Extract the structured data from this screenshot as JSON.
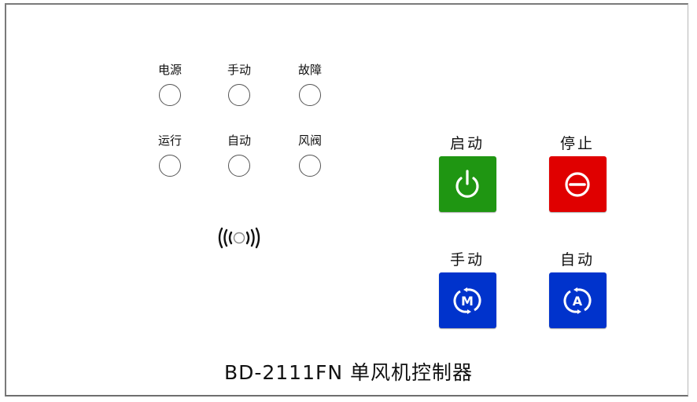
{
  "indicators": [
    {
      "label": "电源",
      "state": "off"
    },
    {
      "label": "手动",
      "state": "off"
    },
    {
      "label": "故障",
      "state": "off"
    },
    {
      "label": "运行",
      "state": "off"
    },
    {
      "label": "自动",
      "state": "off"
    },
    {
      "label": "风阀",
      "state": "off"
    }
  ],
  "buttons": {
    "start": {
      "label": "启动",
      "icon": "power-icon",
      "color": "#1f9612"
    },
    "stop": {
      "label": "停止",
      "icon": "stop-icon",
      "color": "#e00000"
    },
    "manual": {
      "label": "手动",
      "icon": "manual-mode-icon",
      "glyph": "M",
      "color": "#0033cc"
    },
    "auto": {
      "label": "自动",
      "icon": "auto-mode-icon",
      "glyph": "A",
      "color": "#0033cc"
    }
  },
  "nfc_icon": "nfc-reader-icon",
  "footer": {
    "title": "BD-2111FN 单风机控制器"
  }
}
